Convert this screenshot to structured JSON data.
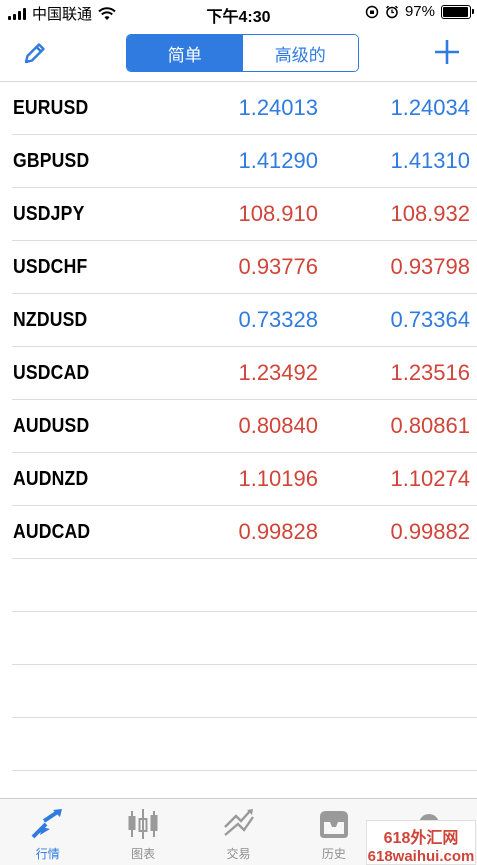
{
  "status_bar": {
    "carrier": "中国联通",
    "time": "下午4:30",
    "battery_percent": "97%",
    "battery_level": 0.97
  },
  "nav": {
    "segments": [
      "简单",
      "高级的"
    ],
    "active_segment": 0
  },
  "quotes": [
    {
      "symbol": "EURUSD",
      "bid": "1.24013",
      "ask": "1.24034",
      "color": "blue"
    },
    {
      "symbol": "GBPUSD",
      "bid": "1.41290",
      "ask": "1.41310",
      "color": "blue"
    },
    {
      "symbol": "USDJPY",
      "bid": "108.910",
      "ask": "108.932",
      "color": "red"
    },
    {
      "symbol": "USDCHF",
      "bid": "0.93776",
      "ask": "0.93798",
      "color": "red"
    },
    {
      "symbol": "NZDUSD",
      "bid": "0.73328",
      "ask": "0.73364",
      "color": "blue"
    },
    {
      "symbol": "USDCAD",
      "bid": "1.23492",
      "ask": "1.23516",
      "color": "red"
    },
    {
      "symbol": "AUDUSD",
      "bid": "0.80840",
      "ask": "0.80861",
      "color": "red"
    },
    {
      "symbol": "AUDNZD",
      "bid": "1.10196",
      "ask": "1.10274",
      "color": "red"
    },
    {
      "symbol": "AUDCAD",
      "bid": "0.99828",
      "ask": "0.99882",
      "color": "red"
    }
  ],
  "colors": {
    "accent": "#2f7be0",
    "up_blue": "#2f7be0",
    "down_red": "#d0453a"
  },
  "tabs": [
    {
      "label": "行情",
      "icon": "quotes-icon",
      "active": true
    },
    {
      "label": "图表",
      "icon": "chart-icon",
      "active": false
    },
    {
      "label": "交易",
      "icon": "trade-icon",
      "active": false
    },
    {
      "label": "历史",
      "icon": "history-icon",
      "active": false
    },
    {
      "label": "",
      "icon": "settings-icon",
      "active": false
    }
  ],
  "watermark": {
    "line1": "618外汇网",
    "line2": "618waihui.com"
  }
}
